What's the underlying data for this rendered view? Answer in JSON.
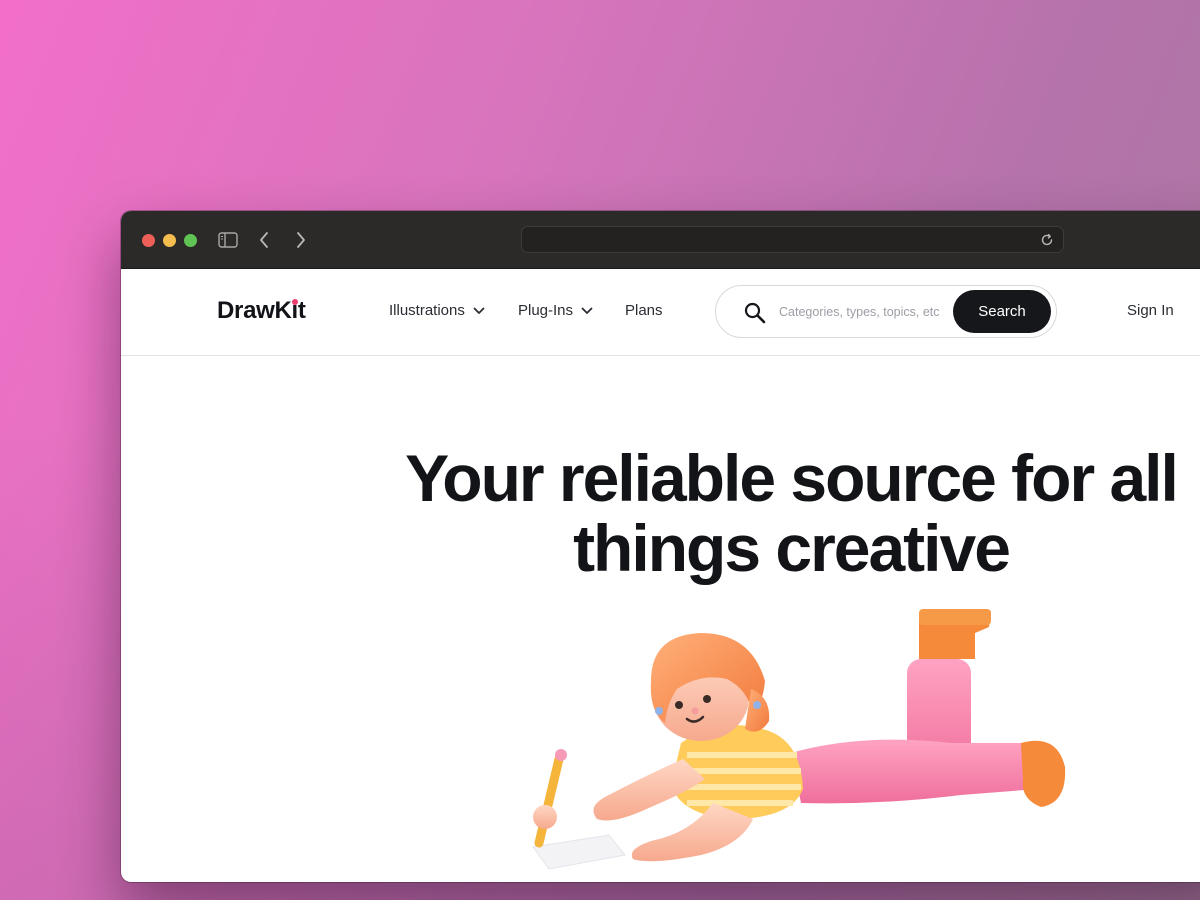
{
  "browser": {
    "url": "",
    "traffic_lights": {
      "close": "#ee5f57",
      "minimize": "#f4bd4f",
      "zoom": "#5fc454"
    },
    "icons": {
      "sidebar": "sidebar-toggle-icon",
      "back": "chevron-left-icon",
      "forward": "chevron-right-icon",
      "reload": "reload-icon"
    }
  },
  "site": {
    "logo": {
      "text": "DrawKit",
      "accent_color": "#ef3b6b"
    },
    "nav": {
      "illustrations": "Illustrations",
      "plugins": "Plug-Ins",
      "plans": "Plans"
    },
    "search": {
      "placeholder": "Categories, types, topics, etc",
      "value": "",
      "button_label": "Search"
    },
    "sign_in": "Sign In"
  },
  "hero": {
    "title_line1": "Your reliable source for all",
    "title_line2": "things creative",
    "illustration": "girl-drawing-illustration"
  },
  "colors": {
    "background_gradient": [
      "#f26fc8",
      "#a97a9e"
    ],
    "titlebar": "#2b2a29",
    "text_dark": "#121418",
    "search_button": "#15171b"
  }
}
